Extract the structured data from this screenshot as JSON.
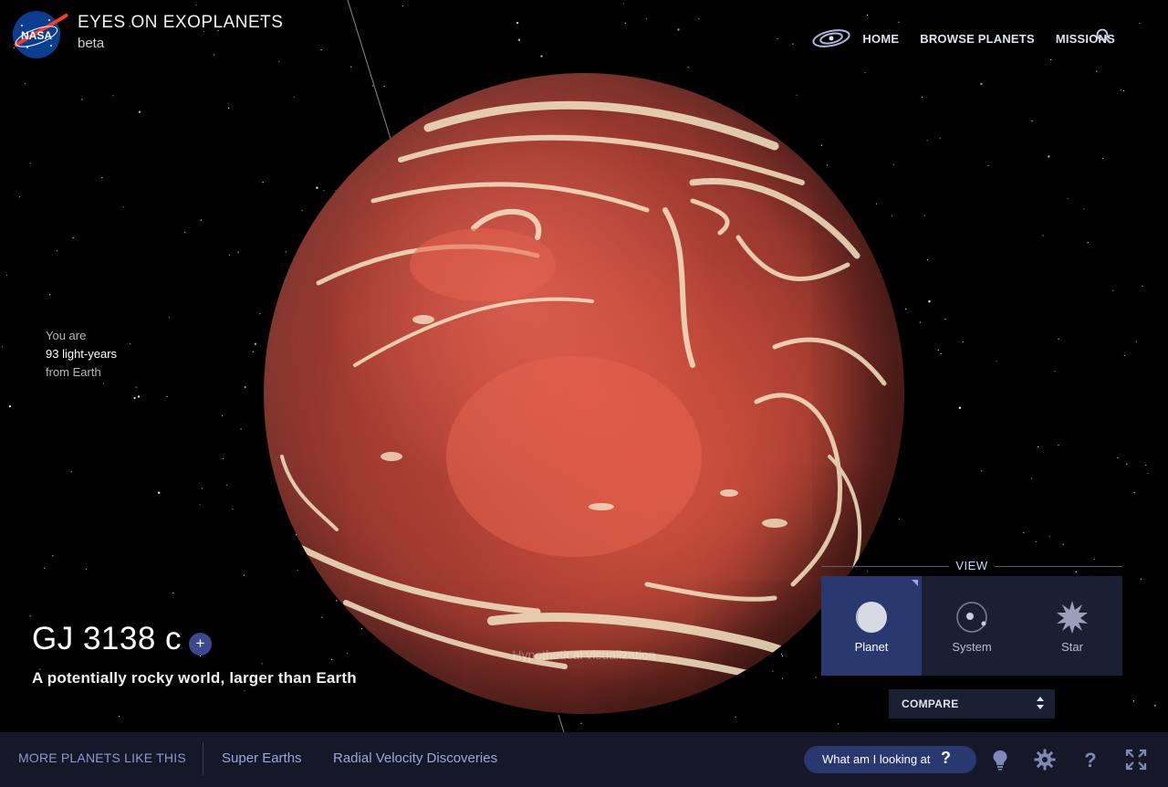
{
  "header": {
    "title": "EYES ON EXOPLANETS",
    "subtitle": "beta",
    "logo_text": "NASA",
    "nav": [
      "HOME",
      "BROWSE PLANETS",
      "MISSIONS"
    ]
  },
  "distance": {
    "line1": "You are",
    "line2": "93 light-years",
    "line3": "from Earth"
  },
  "planet": {
    "name": "GJ 3138 c",
    "add_label": "+",
    "tagline": "A potentially rocky world, larger than Earth",
    "visualization_note": "Hypothetical visualization"
  },
  "view": {
    "title": "VIEW",
    "options": [
      {
        "label": "Planet",
        "icon": "planet-icon",
        "active": true
      },
      {
        "label": "System",
        "icon": "system-icon",
        "active": false
      },
      {
        "label": "Star",
        "icon": "star-icon",
        "active": false
      }
    ],
    "compare_label": "COMPARE"
  },
  "bottom_bar": {
    "more_label": "MORE PLANETS LIKE THIS",
    "categories": [
      "Super Earths",
      "Radial Velocity Discoveries"
    ],
    "what_label": "What am I looking at",
    "what_icon": "?",
    "tools": [
      "lightbulb-icon",
      "settings-icon",
      "help-icon",
      "fullscreen-icon"
    ]
  },
  "colors": {
    "accent": "#2a3870",
    "panel": "#1b1f33",
    "bar": "#141829",
    "link": "#9ba7dc",
    "planet_base": "#c94a3b"
  }
}
